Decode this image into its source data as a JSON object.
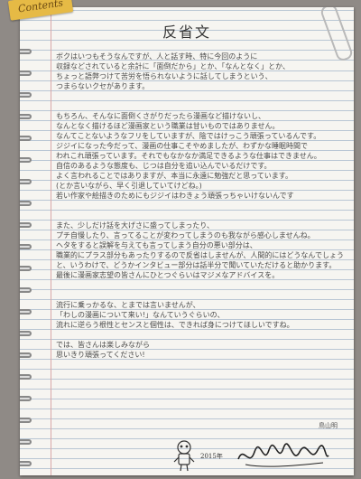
{
  "tab_label": "Contents",
  "title": "反省文",
  "paragraphs": [
    [
      "ボクはいつもそうなんですが、人と話す時、特に今回のように",
      "収録などされていると余計に「面倒だから」とか、「なんとなく」とか、",
      "ちょっと語弊つけて苦労を悟られないように話してしまうという、",
      "つまらないクセがあります。"
    ],
    [
      "もちろん、そんなに面倒くさがりだったら漫画など描けないし、",
      "なんとなく描けるほど漫画家という職業は甘いものではありません。",
      "なんてことないようなフリをしていますが、陰ではけっこう頑張っているんです。",
      "ジジイになった今だって、漫画の仕事こそやめましたが、わずかな睡眠時間で",
      "われこれ頑張っています。それでもなかなか満足できるような仕事はできません。",
      "自信のあるような態度も、じつは自分を追い込んでいるだけです。",
      "よく言われることではありますが、本当に永遠に勉強だと思っています。",
      "(とか言いながら、早く引退していてけどね。)",
      "若い作家や絵描きのためにもジジイはわきょう頑張っちゃいけないんです"
    ],
    [
      "また、少しだけ話を大げさに盛ってしまったり、",
      "プチ自慢したり、言ってることが変わってしまうのも我ながら感心しませんね。",
      "ヘタをすると誤解を与えても言ってしまう自分の悪い部分は、",
      "職業的にプラス部分もあったりするので反省はしませんが、人間的にはどうなんでしょう。",
      "と、いうわけで、どうかインタビュー部分は話半分で聞いていただけると助かります。",
      "最後に漫画家志望の皆さんにひとつぐらいはマジメなアドバイスを。"
    ],
    [
      "流行に乗っかるな、とまでは言いませんが、",
      "「わしの漫画について来い!」なんていうぐらいの、",
      "流れに逆らう根性とセンスと個性は、できれば身につけてほしいですね。"
    ],
    [
      "では、皆さんは楽しみながら",
      "思いきり頑張ってください!"
    ]
  ],
  "author": "鳥山明",
  "signature_year": "2015年"
}
